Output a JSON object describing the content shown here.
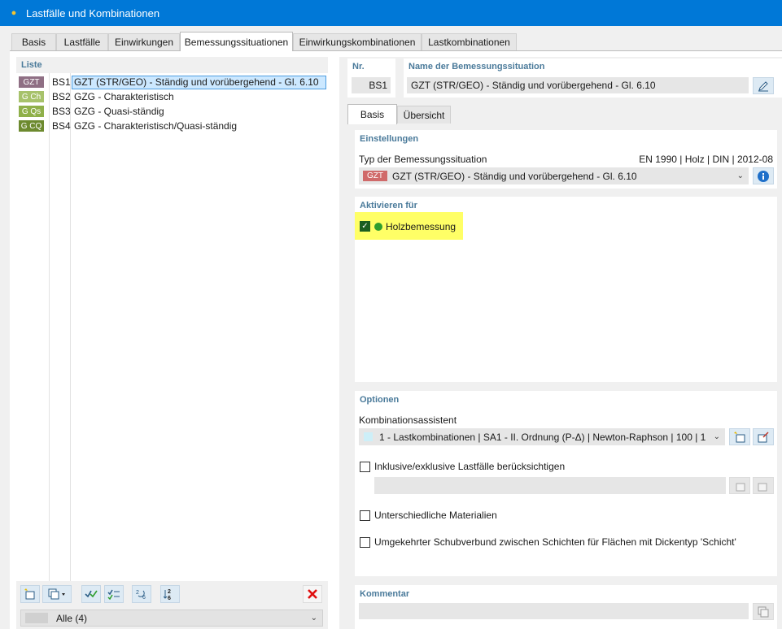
{
  "window": {
    "title": "Lastfälle und Kombinationen"
  },
  "tabs": [
    {
      "label": "Basis"
    },
    {
      "label": "Lastfälle"
    },
    {
      "label": "Einwirkungen"
    },
    {
      "label": "Bemessungssituationen"
    },
    {
      "label": "Einwirkungskombinationen"
    },
    {
      "label": "Lastkombinationen"
    }
  ],
  "list": {
    "label": "Liste",
    "items": [
      {
        "badge": "GZT",
        "badge_color": "#8f6f84",
        "code": "BS1",
        "text": "GZT (STR/GEO) - Ständig und vorübergehend - Gl. 6.10"
      },
      {
        "badge": "G Ch",
        "badge_color": "#a7c26b",
        "code": "BS2",
        "text": "GZG - Charakteristisch"
      },
      {
        "badge": "G Qs",
        "badge_color": "#8fb04a",
        "code": "BS3",
        "text": "GZG - Quasi-ständig"
      },
      {
        "badge": "G CQ",
        "badge_color": "#6d8a2f",
        "code": "BS4",
        "text": "GZG - Charakteristisch/Quasi-ständig"
      }
    ],
    "filter": "Alle (4)"
  },
  "detail": {
    "nr_label": "Nr.",
    "nr_value": "BS1",
    "name_label": "Name der Bemessungssituation",
    "name_value": "GZT (STR/GEO) - Ständig und vorübergehend - Gl. 6.10",
    "subtabs": [
      "Basis",
      "Übersicht"
    ],
    "einstellungen": {
      "title": "Einstellungen",
      "type_label": "Typ der Bemessungssituation",
      "standard": "EN 1990 | Holz | DIN | 2012-08",
      "type_badge": "GZT",
      "type_value": "GZT (STR/GEO) - Ständig und vorübergehend - Gl. 6.10"
    },
    "aktivieren": {
      "title": "Aktivieren für",
      "item": "Holzbemessung"
    },
    "optionen": {
      "title": "Optionen",
      "assistant_label": "Kombinationsassistent",
      "assistant_value": "1 - Lastkombinationen | SA1 - II. Ordnung (P-Δ) | Newton-Raphson | 100 | 1",
      "opt1": "Inklusive/exklusive Lastfälle berücksichtigen",
      "opt2": "Unterschiedliche Materialien",
      "opt3": "Umgekehrter Schubverbund zwischen Schichten für Flächen mit Dickentyp 'Schicht'"
    },
    "kommentar": {
      "title": "Kommentar"
    }
  },
  "colors": {
    "titlebar": "#0078d7",
    "section_title": "#4a7a9a",
    "highlight": "#ffff66"
  }
}
